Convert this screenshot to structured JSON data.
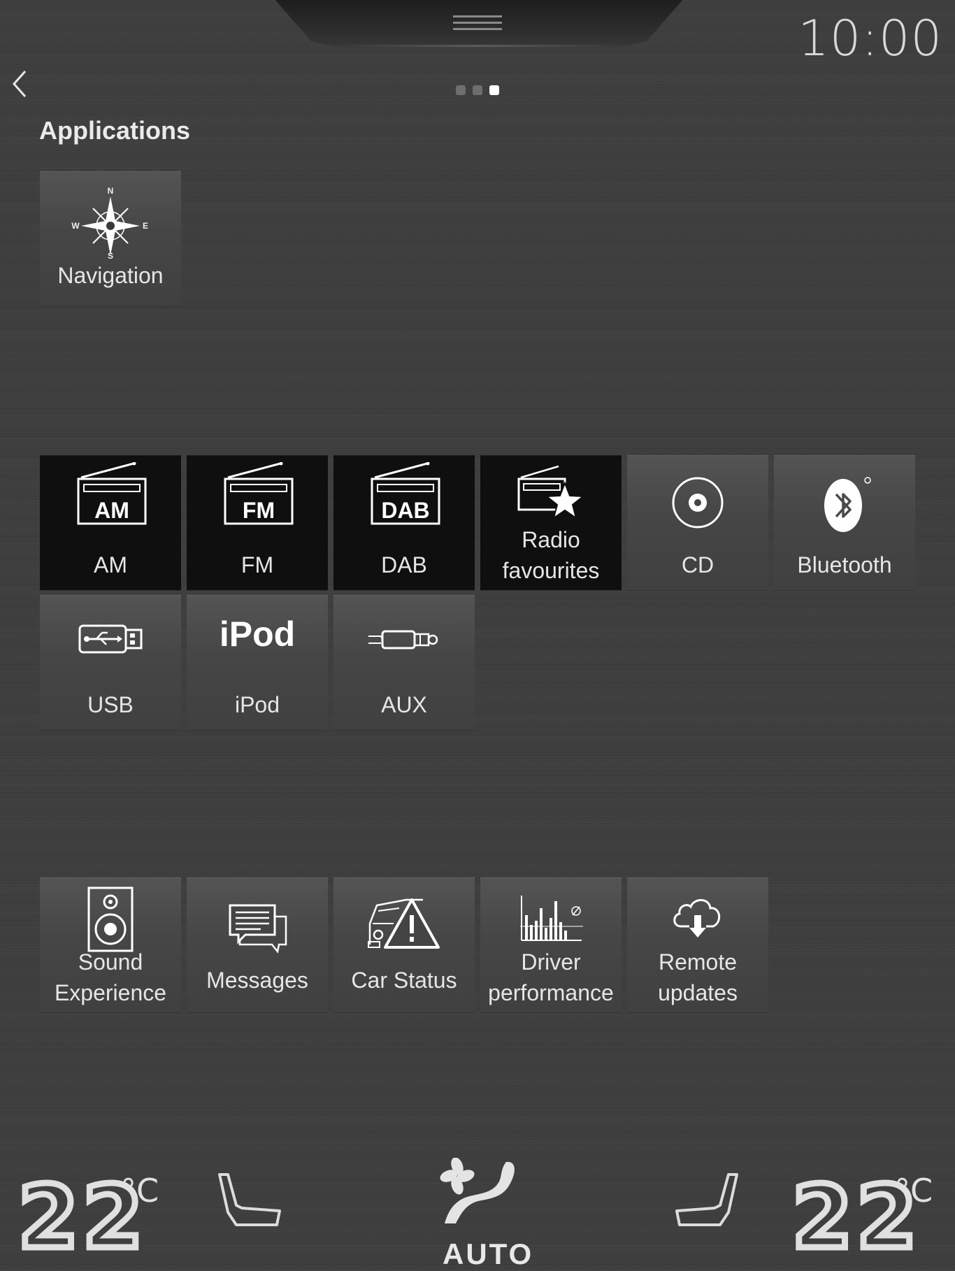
{
  "status_bar": {
    "time": "10:00"
  },
  "navigation": {
    "back_icon": "chevron-left-icon",
    "page_count": 3,
    "active_page": 3
  },
  "section": {
    "title": "Applications"
  },
  "apps": {
    "navigation": {
      "label": "Navigation",
      "icon": "compass-icon"
    },
    "am": {
      "label": "AM",
      "icon_text": "AM",
      "icon": "radio-icon"
    },
    "fm": {
      "label": "FM",
      "icon_text": "FM",
      "icon": "radio-icon"
    },
    "dab": {
      "label": "DAB",
      "icon_text": "DAB",
      "icon": "radio-icon"
    },
    "radio_favourites": {
      "label_line1": "Radio",
      "label_line2": "favourites",
      "icon": "radio-star-icon"
    },
    "cd": {
      "label": "CD",
      "icon": "disc-icon"
    },
    "bluetooth": {
      "label": "Bluetooth",
      "icon": "bluetooth-icon"
    },
    "usb": {
      "label": "USB",
      "icon": "usb-icon"
    },
    "ipod": {
      "label": "iPod",
      "icon_text": "iPod"
    },
    "aux": {
      "label": "AUX",
      "icon": "aux-plug-icon"
    },
    "sound_experience": {
      "label_line1": "Sound",
      "label_line2": "Experience",
      "icon": "speaker-icon"
    },
    "messages": {
      "label": "Messages",
      "icon": "messages-icon"
    },
    "car_status": {
      "label": "Car Status",
      "icon": "car-warning-icon"
    },
    "driver_performance": {
      "label_line1": "Driver",
      "label_line2": "performance",
      "icon": "bar-chart-icon"
    },
    "remote_updates": {
      "label_line1": "Remote",
      "label_line2": "updates",
      "icon": "cloud-download-icon"
    }
  },
  "climate": {
    "left_temp": "22",
    "right_temp": "22",
    "unit": "°C",
    "mode": "AUTO"
  },
  "colors": {
    "background": "#3d3d3d",
    "tile": "#4a4a4a",
    "tile_active": "#0f0f0f",
    "text": "#e6e6e6"
  }
}
